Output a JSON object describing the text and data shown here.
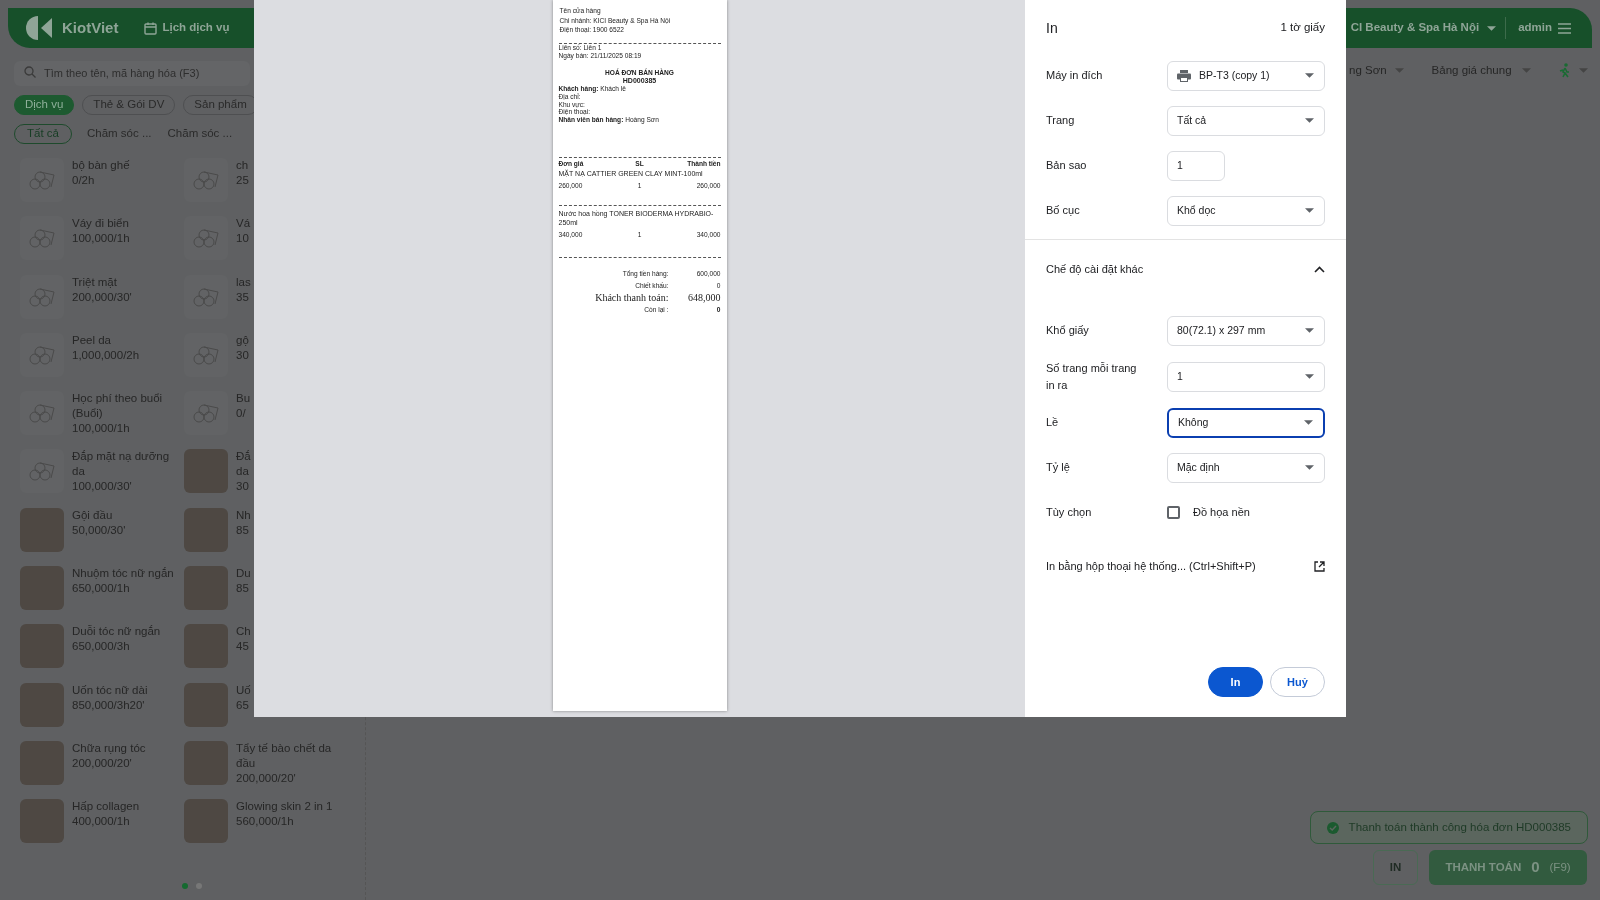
{
  "header": {
    "logo": "KiotViet",
    "nav": [
      {
        "label": "Lịch dịch vụ"
      }
    ],
    "branch": "CI Beauty & Spa Hà Nội",
    "user": "admin"
  },
  "search": {
    "placeholder": "Tìm theo tên, mã hàng hóa (F3)"
  },
  "type_tabs": [
    {
      "label": "Dịch vụ",
      "selected": true
    },
    {
      "label": "Thẻ & Gói DV",
      "selected": false
    },
    {
      "label": "Sản phẩm",
      "selected": false
    }
  ],
  "category_tabs": [
    {
      "label": "Tất cả",
      "selected": true
    },
    {
      "label": "Chăm sóc ...",
      "selected": false
    },
    {
      "label": "Chăm sóc ...",
      "selected": false
    }
  ],
  "services": [
    {
      "kind": "placeholder",
      "clipped": false,
      "name": "bộ bàn ghế",
      "price": "0/2h"
    },
    {
      "kind": "placeholder",
      "clipped": true,
      "name": "ch",
      "price": "25"
    },
    {
      "kind": "placeholder",
      "clipped": false,
      "name": "Váy đi biển",
      "price": "100,000/1h"
    },
    {
      "kind": "placeholder",
      "clipped": true,
      "name": "Vá",
      "price": "10"
    },
    {
      "kind": "placeholder",
      "clipped": false,
      "name": "Triệt mặt",
      "price": "200,000/30'"
    },
    {
      "kind": "placeholder",
      "clipped": true,
      "name": "las",
      "price": "35"
    },
    {
      "kind": "placeholder",
      "clipped": false,
      "name": "Peel da",
      "price": "1,000,000/2h"
    },
    {
      "kind": "placeholder",
      "clipped": true,
      "name": "gộ",
      "price": "30"
    },
    {
      "kind": "placeholder",
      "clipped": false,
      "name": "Học phí theo buổi (Buổi)",
      "price": "100,000/1h"
    },
    {
      "kind": "placeholder",
      "clipped": true,
      "name": "Bu",
      "price": "0/"
    },
    {
      "kind": "placeholder",
      "clipped": false,
      "name": "Đắp mặt nạ dưỡng da",
      "price": "100,000/30'"
    },
    {
      "kind": "photo",
      "clipped": true,
      "name": "Đắ da",
      "price": "30"
    },
    {
      "kind": "photo",
      "clipped": false,
      "name": "Gội đầu",
      "price": "50,000/30'"
    },
    {
      "kind": "photo",
      "clipped": true,
      "name": "Nh",
      "price": "85"
    },
    {
      "kind": "photo",
      "clipped": false,
      "name": "Nhuộm tóc nữ ngắn",
      "price": "650,000/1h"
    },
    {
      "kind": "photo",
      "clipped": true,
      "name": "Du",
      "price": "85"
    },
    {
      "kind": "photo",
      "clipped": false,
      "name": "Duỗi tóc nữ ngắn",
      "price": "650,000/3h"
    },
    {
      "kind": "photo",
      "clipped": true,
      "name": "Ch",
      "price": "45"
    },
    {
      "kind": "photo",
      "clipped": false,
      "name": "Uốn tóc nữ dài",
      "price": "850,000/3h20'"
    },
    {
      "kind": "photo",
      "clipped": true,
      "name": "Uố",
      "price": "65"
    },
    {
      "kind": "photo",
      "clipped": false,
      "name": "Chữa rụng tóc",
      "price": "200,000/20'"
    },
    {
      "kind": "photo",
      "clipped": false,
      "name": "Tẩy tế bào chết da đầu",
      "price": "200,000/20'"
    },
    {
      "kind": "photo",
      "clipped": false,
      "name": "Hấp collagen",
      "price": "400,000/1h"
    },
    {
      "kind": "photo",
      "clipped": false,
      "name": "Glowing skin 2 in 1",
      "price": "560,000/1h"
    }
  ],
  "pagination": [
    {
      "selected": true
    },
    {
      "selected": false
    }
  ],
  "toolbar": {
    "staff": "ng Sơn",
    "price_list": "Bảng giá chung"
  },
  "toast": "Thanh toán thành công hóa đơn HD000385",
  "actions": {
    "print": "IN",
    "pay": "THANH TOÁN",
    "pay_amount": "0",
    "pay_shortcut": "(F9)"
  },
  "receipt": {
    "store": [
      "Tên cửa hàng",
      "Chi nhánh: KICI Beauty & Spa Hà Nội",
      "Điện thoại: 1900 6522"
    ],
    "meta": [
      "Liên số: Liên 1",
      "Ngày bán: 21/11/2025 08:19"
    ],
    "title": "HOÁ ĐƠN BÁN HÀNG",
    "code": "HD000385",
    "customer": [
      "**Khách hàng:** Khách lẻ",
      "Địa chỉ:",
      "Khu vực:",
      "Điện thoại:",
      "**Nhân viên bán hàng:** Hoàng Sơn"
    ],
    "columns": [
      "Đơn giá",
      "SL",
      "Thành tiền"
    ],
    "items": [
      {
        "name": "MẶT NẠ CATTIER GREEN CLAY MINT-100ml",
        "price": "260,000",
        "qty": "1",
        "total": "260,000"
      },
      {
        "name": "Nước hoa hồng TONER BIODERMA HYDRABIO-250ml",
        "price": "340,000",
        "qty": "1",
        "total": "340,000"
      }
    ],
    "totals": [
      {
        "kind": "normal",
        "label": "Tổng tiền hàng:",
        "value": "600,000"
      },
      {
        "kind": "normal",
        "label": "Chiết khấu:",
        "value": "0"
      },
      {
        "kind": "large",
        "label": "Khách thanh toán:",
        "value": "648,000"
      },
      {
        "kind": "strong",
        "label": "Còn lại :",
        "value": "0"
      }
    ]
  },
  "print_dialog": {
    "title": "In",
    "sheets": "1 tờ giấy",
    "settings": [
      {
        "kind": "printer",
        "label": "Máy in đích",
        "value": "BP-T3 (copy 1)",
        "focused": false
      },
      {
        "kind": "select",
        "label": "Trang",
        "value": "Tất cả",
        "focused": false
      },
      {
        "kind": "number",
        "label": "Bản sao",
        "value": "1"
      },
      {
        "kind": "select",
        "label": "Bố cục",
        "value": "Khổ dọc",
        "focused": false
      }
    ],
    "more_settings": {
      "label": "Chế độ cài đặt khác",
      "expanded": true
    },
    "more": [
      {
        "kind": "select",
        "label": "Khổ giấy",
        "value": "80(72.1) x 297 mm",
        "focused": false
      },
      {
        "kind": "select",
        "label": "Số trang mỗi trang in ra",
        "value": "1",
        "focused": false
      },
      {
        "kind": "select",
        "label": "Lề",
        "value": "Không",
        "focused": true
      },
      {
        "kind": "select",
        "label": "Tỷ lệ",
        "value": "Mặc định",
        "focused": false
      },
      {
        "kind": "checkbox",
        "label": "Tùy chọn",
        "option": "Đồ họa nền",
        "checked": false
      }
    ],
    "system_dialog": "In bằng hộp thoại hệ thống... (Ctrl+Shift+P)",
    "buttons": [
      {
        "kind": "primary",
        "label": "In"
      },
      {
        "kind": "secondary",
        "label": "Huỷ"
      }
    ]
  }
}
